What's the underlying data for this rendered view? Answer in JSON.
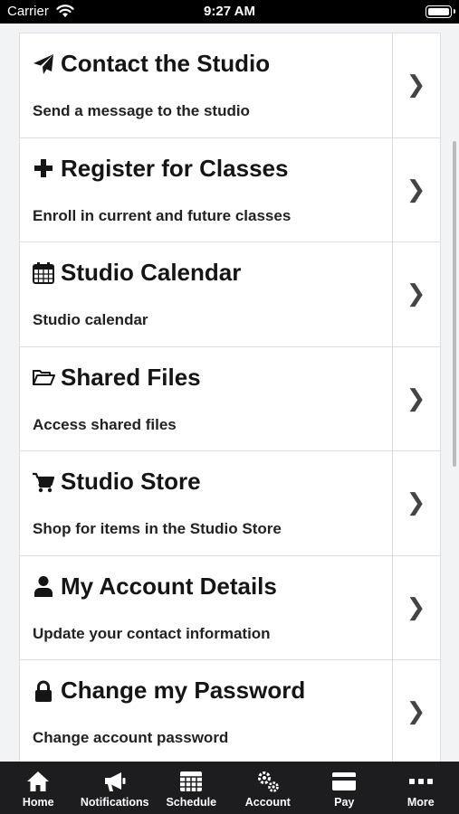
{
  "status_bar": {
    "carrier": "Carrier",
    "time": "9:27 AM"
  },
  "menu": {
    "items": [
      {
        "icon": "paper-plane-icon",
        "title": "Contact the Studio",
        "description": "Send a message to the studio"
      },
      {
        "icon": "plus-icon",
        "title": "Register for Classes",
        "description": "Enroll in current and future classes"
      },
      {
        "icon": "calendar-icon",
        "title": "Studio Calendar",
        "description": "Studio calendar"
      },
      {
        "icon": "folder-open-icon",
        "title": "Shared Files",
        "description": "Access shared files"
      },
      {
        "icon": "shopping-cart-icon",
        "title": "Studio Store",
        "description": "Shop for items in the Studio Store"
      },
      {
        "icon": "user-icon",
        "title": "My Account Details",
        "description": "Update your contact information"
      },
      {
        "icon": "lock-icon",
        "title": "Change my Password",
        "description": "Change account password"
      }
    ],
    "chevron": "❯"
  },
  "tab_bar": {
    "tabs": [
      {
        "icon": "home-icon",
        "label": "Home"
      },
      {
        "icon": "megaphone-icon",
        "label": "Notifications"
      },
      {
        "icon": "calendar-grid-icon",
        "label": "Schedule"
      },
      {
        "icon": "gears-icon",
        "label": "Account"
      },
      {
        "icon": "credit-card-icon",
        "label": "Pay"
      },
      {
        "icon": "ellipsis-icon",
        "label": "More"
      }
    ]
  },
  "colors": {
    "background": "#f2f3f5",
    "tab_bar": "#1d1d1f",
    "status_bar": "#000000"
  }
}
